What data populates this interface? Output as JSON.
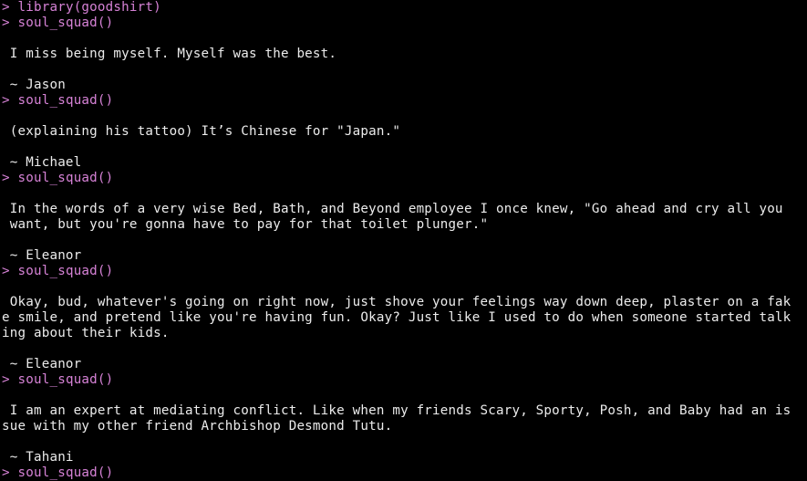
{
  "colors": {
    "background": "#000000",
    "command_text": "#d682d6",
    "output_text": "#ececec"
  },
  "console": {
    "prompt_symbol": ">",
    "lines": [
      {
        "kind": "cmd",
        "text": "library(goodshirt)"
      },
      {
        "kind": "cmd",
        "text": "soul_squad()"
      },
      {
        "kind": "blank",
        "text": ""
      },
      {
        "kind": "out",
        "text": " I miss being myself. Myself was the best."
      },
      {
        "kind": "blank",
        "text": ""
      },
      {
        "kind": "out",
        "text": " ~ Jason"
      },
      {
        "kind": "cmd",
        "text": "soul_squad()"
      },
      {
        "kind": "blank",
        "text": ""
      },
      {
        "kind": "out",
        "text": " (explaining his tattoo) It’s Chinese for \"Japan.\""
      },
      {
        "kind": "blank",
        "text": ""
      },
      {
        "kind": "out",
        "text": " ~ Michael"
      },
      {
        "kind": "cmd",
        "text": "soul_squad()"
      },
      {
        "kind": "blank",
        "text": ""
      },
      {
        "kind": "out",
        "text": " In the words of a very wise Bed, Bath, and Beyond employee I once knew, \"Go ahead and cry all you"
      },
      {
        "kind": "out",
        "text": " want, but you're gonna have to pay for that toilet plunger.\""
      },
      {
        "kind": "blank",
        "text": ""
      },
      {
        "kind": "out",
        "text": " ~ Eleanor"
      },
      {
        "kind": "cmd",
        "text": "soul_squad()"
      },
      {
        "kind": "blank",
        "text": ""
      },
      {
        "kind": "out",
        "text": " Okay, bud, whatever's going on right now, just shove your feelings way down deep, plaster on a fak"
      },
      {
        "kind": "out",
        "text": "e smile, and pretend like you're having fun. Okay? Just like I used to do when someone started talk"
      },
      {
        "kind": "out",
        "text": "ing about their kids."
      },
      {
        "kind": "blank",
        "text": ""
      },
      {
        "kind": "out",
        "text": " ~ Eleanor"
      },
      {
        "kind": "cmd",
        "text": "soul_squad()"
      },
      {
        "kind": "blank",
        "text": ""
      },
      {
        "kind": "out",
        "text": " I am an expert at mediating conflict. Like when my friends Scary, Sporty, Posh, and Baby had an is"
      },
      {
        "kind": "out",
        "text": "sue with my other friend Archbishop Desmond Tutu."
      },
      {
        "kind": "blank",
        "text": ""
      },
      {
        "kind": "out",
        "text": " ~ Tahani"
      },
      {
        "kind": "cmd",
        "text": "soul_squad()"
      }
    ]
  }
}
